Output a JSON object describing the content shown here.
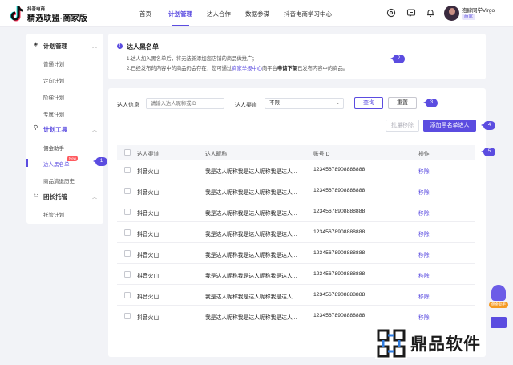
{
  "brand": {
    "small_title": "抖音电商",
    "main_title": "精选联盟·商家版"
  },
  "nav": {
    "items": [
      "首页",
      "计划管理",
      "达人合作",
      "数据参谋",
      "抖音电商学习中心"
    ],
    "active": "计划管理"
  },
  "header_icons": [
    "help-circle-icon",
    "message-icon",
    "bell-icon"
  ],
  "user": {
    "name": "抱肆同学Virgo",
    "badge": "商家"
  },
  "sidebar": {
    "groups": [
      {
        "title": "计划管理",
        "icon": "plan-icon",
        "items": [
          "普通计划",
          "定向计划",
          "阶梯计划",
          "专属计划"
        ]
      },
      {
        "title": "计划工具",
        "icon": "tool-icon",
        "items": [
          "佣金助手",
          "达人黑名单",
          "商品清退历史"
        ]
      },
      {
        "title": "团长托管",
        "icon": "group-icon",
        "items": [
          "托管计划"
        ]
      }
    ],
    "active_item": "达人黑名单",
    "new_tag": "New"
  },
  "notice": {
    "title": "达人黑名单",
    "line1": "1.达人加入黑名单后，将无法新添加您店铺的商品做推广；",
    "line2_pre": "2.已经发布的内容中的商品仍会存在，您可通过",
    "line2_link": "商家举报中心",
    "line2_mid": "向平台",
    "line2_strong": "申请下架",
    "line2_post": "已发布内容中的商品。"
  },
  "filters": {
    "talent_info_label": "达人信息",
    "talent_info_placeholder": "请输入达人昵称或ID",
    "channel_label": "达人渠道",
    "channel_value": "不限",
    "search_button": "查询",
    "reset_button": "重置"
  },
  "actions": {
    "batch_remove": "批量移除",
    "add_blacklist": "添加黑名单达人"
  },
  "table": {
    "columns": [
      "达人渠道",
      "达人昵称",
      "账号ID",
      "操作"
    ],
    "rows": [
      {
        "channel": "抖音火山",
        "nickname": "我是达人昵称我是达人昵称我是达人...",
        "account_id": "12345678908888888",
        "action": "移除"
      },
      {
        "channel": "抖音火山",
        "nickname": "我是达人昵称我是达人昵称我是达人...",
        "account_id": "12345678908888888",
        "action": "移除"
      },
      {
        "channel": "抖音火山",
        "nickname": "我是达人昵称我是达人昵称我是达人...",
        "account_id": "12345678908888888",
        "action": "移除"
      },
      {
        "channel": "抖音火山",
        "nickname": "我是达人昵称我是达人昵称我是达人...",
        "account_id": "12345678908888888",
        "action": "移除"
      },
      {
        "channel": "抖音火山",
        "nickname": "我是达人昵称我是达人昵称我是达人...",
        "account_id": "12345678908888888",
        "action": "移除"
      },
      {
        "channel": "抖音火山",
        "nickname": "我是达人昵称我是达人昵称我是达人...",
        "account_id": "12345678908888888",
        "action": "移除"
      },
      {
        "channel": "抖音火山",
        "nickname": "我是达人昵称我是达人昵称我是达人...",
        "account_id": "12345678908888888",
        "action": "移除"
      },
      {
        "channel": "抖音火山",
        "nickname": "我是达人昵称我是达人昵称我是达人...",
        "account_id": "12345678908888888",
        "action": "移除"
      }
    ]
  },
  "markers": [
    "1",
    "2",
    "3",
    "4",
    "5"
  ],
  "float_help": {
    "label": "佣金助手"
  },
  "watermark": {
    "text": "鼎品软件"
  },
  "colors": {
    "accent": "#5b4ce0",
    "new_tag": "#ff5a5f",
    "background": "#f2f3f7"
  }
}
